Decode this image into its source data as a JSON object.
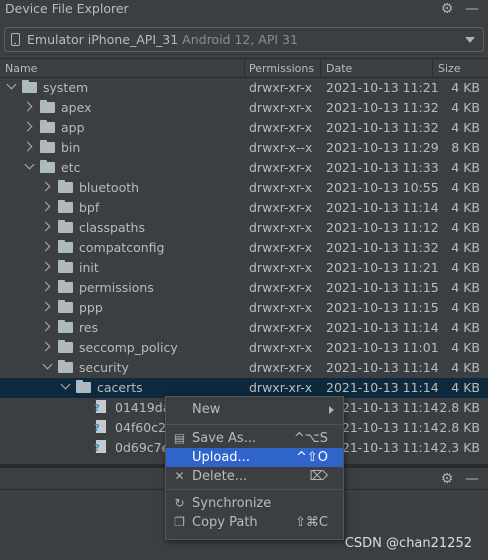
{
  "window": {
    "title": "Device File Explorer",
    "settings_icon": "gear-icon",
    "minimize_icon": "minus-icon"
  },
  "device_selector": {
    "device_name": "Emulator iPhone_API_31",
    "device_info": "Android 12, API 31",
    "icon": "phone-icon"
  },
  "table": {
    "columns": [
      "Name",
      "Permissions",
      "Date",
      "Size"
    ],
    "rows": [
      {
        "name": "system",
        "perm": "drwxr-xr-x",
        "date": "2021-10-13 11:21",
        "size": "4 KB",
        "type": "folder",
        "state": "expanded",
        "level": 0
      },
      {
        "name": "apex",
        "perm": "drwxr-xr-x",
        "date": "2021-10-13 11:32",
        "size": "4 KB",
        "type": "folder",
        "state": "collapsed",
        "level": 1
      },
      {
        "name": "app",
        "perm": "drwxr-xr-x",
        "date": "2021-10-13 11:32",
        "size": "4 KB",
        "type": "folder",
        "state": "collapsed",
        "level": 1
      },
      {
        "name": "bin",
        "perm": "drwxr-x--x",
        "date": "2021-10-13 11:29",
        "size": "8 KB",
        "type": "folder",
        "state": "collapsed",
        "level": 1
      },
      {
        "name": "etc",
        "perm": "drwxr-xr-x",
        "date": "2021-10-13 11:33",
        "size": "4 KB",
        "type": "folder",
        "state": "expanded",
        "level": 1
      },
      {
        "name": "bluetooth",
        "perm": "drwxr-xr-x",
        "date": "2021-10-13 10:55",
        "size": "4 KB",
        "type": "folder",
        "state": "collapsed",
        "level": 2
      },
      {
        "name": "bpf",
        "perm": "drwxr-xr-x",
        "date": "2021-10-13 11:14",
        "size": "4 KB",
        "type": "folder",
        "state": "collapsed",
        "level": 2
      },
      {
        "name": "classpaths",
        "perm": "drwxr-xr-x",
        "date": "2021-10-13 11:12",
        "size": "4 KB",
        "type": "folder",
        "state": "collapsed",
        "level": 2
      },
      {
        "name": "compatconfig",
        "perm": "drwxr-xr-x",
        "date": "2021-10-13 11:32",
        "size": "4 KB",
        "type": "folder",
        "state": "collapsed",
        "level": 2
      },
      {
        "name": "init",
        "perm": "drwxr-xr-x",
        "date": "2021-10-13 11:21",
        "size": "4 KB",
        "type": "folder",
        "state": "collapsed",
        "level": 2
      },
      {
        "name": "permissions",
        "perm": "drwxr-xr-x",
        "date": "2021-10-13 11:15",
        "size": "4 KB",
        "type": "folder",
        "state": "collapsed",
        "level": 2
      },
      {
        "name": "ppp",
        "perm": "drwxr-xr-x",
        "date": "2021-10-13 11:15",
        "size": "4 KB",
        "type": "folder",
        "state": "collapsed",
        "level": 2
      },
      {
        "name": "res",
        "perm": "drwxr-xr-x",
        "date": "2021-10-13 11:14",
        "size": "4 KB",
        "type": "folder",
        "state": "collapsed",
        "level": 2
      },
      {
        "name": "seccomp_policy",
        "perm": "drwxr-xr-x",
        "date": "2021-10-13 11:01",
        "size": "4 KB",
        "type": "folder",
        "state": "collapsed",
        "level": 2
      },
      {
        "name": "security",
        "perm": "drwxr-xr-x",
        "date": "2021-10-13 11:14",
        "size": "4 KB",
        "type": "folder",
        "state": "expanded",
        "level": 2
      },
      {
        "name": "cacerts",
        "perm": "drwxr-xr-x",
        "date": "2021-10-13 11:14",
        "size": "4 KB",
        "type": "folder",
        "state": "expanded",
        "level": 3,
        "selected": true
      },
      {
        "name": "01419da9",
        "perm": "",
        "date": "2021-10-13 11:14",
        "size": "2.8 KB",
        "type": "file",
        "level": 4
      },
      {
        "name": "04f60c28",
        "perm": "",
        "date": "2021-10-13 11:14",
        "size": "2.8 KB",
        "type": "file",
        "level": 4
      },
      {
        "name": "0d69c7e",
        "perm": "",
        "date": "2021-10-13 11:14",
        "size": "2.3 KB",
        "type": "file",
        "level": 4
      }
    ]
  },
  "context_menu": {
    "items": [
      {
        "label": "New",
        "shortcut": "",
        "icon": "",
        "submenu": true
      },
      {
        "separator": true
      },
      {
        "label": "Save As...",
        "shortcut": "^⌥S",
        "icon": "save-icon"
      },
      {
        "label": "Upload...",
        "shortcut": "^⇧O",
        "icon": "",
        "active": true
      },
      {
        "label": "Delete...",
        "shortcut": "⌦",
        "icon": "delete-icon"
      },
      {
        "separator": true
      },
      {
        "label": "Synchronize",
        "shortcut": "",
        "icon": "sync-icon"
      },
      {
        "label": "Copy Path",
        "shortcut": "⇧⌘C",
        "icon": "copy-icon"
      }
    ]
  },
  "watermark": "CSDN @chan21252"
}
